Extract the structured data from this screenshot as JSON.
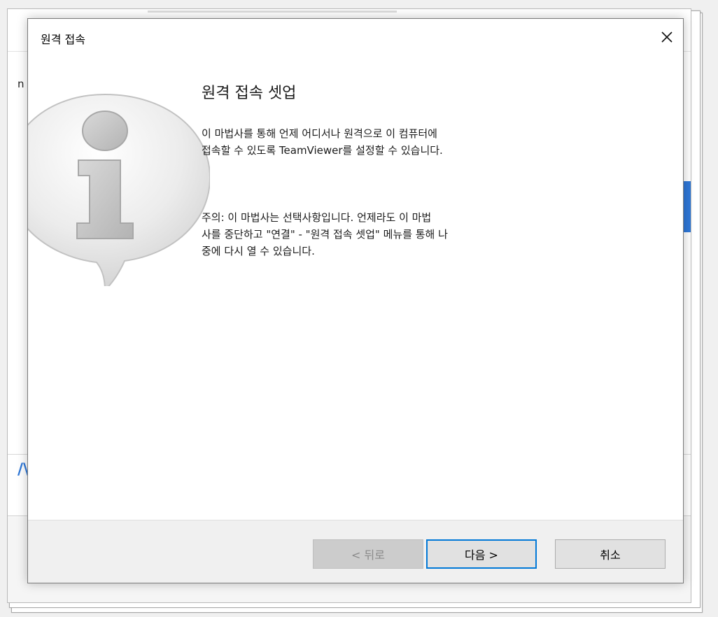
{
  "dialog": {
    "title": "원격 접속",
    "close_icon": "close-icon"
  },
  "content": {
    "heading": "원격 접속 셋업",
    "description": "이 마법사를 통해 언제 어디서나 원격으로 이 컴퓨터에\n접속할 수 있도록 TeamViewer를 설정할 수 있습니다.",
    "note": "주의: 이 마법사는 선택사항입니다. 언제라도 이 마법\n사를 중단하고 \"연결\" - \"원격 접속 셋업\" 메뉴를 통해 나\n중에 다시 열 수 있습니다.",
    "info_icon": "info-speech-bubble-icon"
  },
  "buttons": {
    "back_label": "< 뒤로",
    "next_label": "다음 >",
    "cancel_label": "취소"
  },
  "background_window": {
    "partial_text": "n"
  },
  "colors": {
    "accent": "#0078d7",
    "background_blue": "#2f78d8"
  }
}
